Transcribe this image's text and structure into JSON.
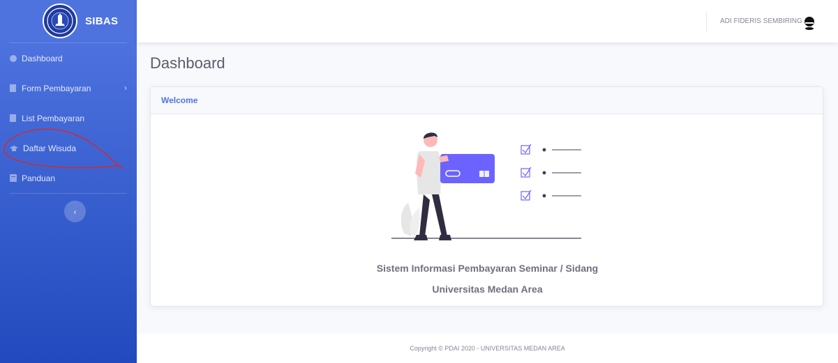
{
  "brand": {
    "name": "SIBAS",
    "logo_icon": "university-seal-icon"
  },
  "sidebar": {
    "items": [
      {
        "label": "Dashboard",
        "icon": "dashboard-icon"
      },
      {
        "label": "Form Pembayaran",
        "icon": "file-icon",
        "has_submenu": true
      },
      {
        "label": "List Pembayaran",
        "icon": "file-icon"
      },
      {
        "label": "Daftar Wisuda",
        "icon": "graduation-cap-icon"
      },
      {
        "label": "Panduan",
        "icon": "book-icon"
      }
    ],
    "toggle_icon": "chevron-left-icon"
  },
  "topbar": {
    "user_name": "ADI FIDERIS SEMBIRING",
    "avatar_icon": "user-avatar-icon"
  },
  "main": {
    "page_title": "Dashboard",
    "card": {
      "header": "Welcome",
      "caption_line1": "Sistem Informasi Pembayaran Seminar / Sidang",
      "caption_line2": "Universitas Medan Area"
    }
  },
  "footer": {
    "copyright": "Copyright © PDAI 2020 - UNIVERSITAS MEDAN AREA"
  },
  "colors": {
    "primary": "#4e73df",
    "primary_dark": "#224abe",
    "text_gray": "#5a5c69",
    "accent_purple": "#6c63ff",
    "annotation_red": "#d62828"
  }
}
